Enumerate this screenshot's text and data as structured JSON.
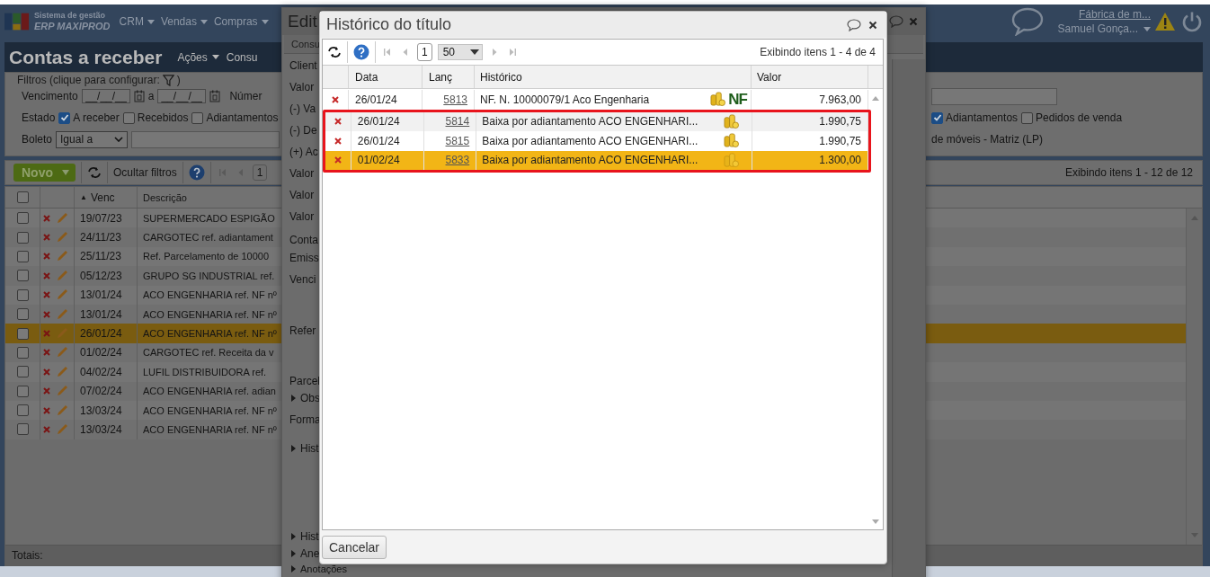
{
  "header": {
    "brand_line1": "Sistema de gestão",
    "brand_line2": "ERP MAXIPROD",
    "menus": [
      {
        "label": "CRM"
      },
      {
        "label": "Vendas"
      },
      {
        "label": "Compras"
      }
    ],
    "company": "Fábrica de m...",
    "user": "Samuel Gonça..."
  },
  "page": {
    "title": "Contas a receber",
    "menus": [
      {
        "label": "Ações",
        "caret": true
      },
      {
        "label": "Consu",
        "caret": false
      }
    ],
    "filters": {
      "legend": "Filtros (clique para configurar:",
      "legend_end": ")",
      "due_label": "Vencimento",
      "date_from": "__/__/__",
      "range_sep": "a",
      "date_to": "__/__/__",
      "number_label": "Númer",
      "state_label": "Estado",
      "states": [
        {
          "label": "A receber",
          "checked": true
        },
        {
          "label": "Recebidos",
          "checked": false
        },
        {
          "label": "Adiantamentos",
          "checked": false
        }
      ],
      "states_right": [
        {
          "label": "Adiantamentos",
          "checked": true
        },
        {
          "label": "Pedidos de venda",
          "checked": false
        }
      ],
      "boleto_label": "Boleto",
      "boleto_op": "Igual a",
      "company_text": "de móveis - Matriz (LP)"
    },
    "toolbar": {
      "new_label": "Novo",
      "hide_filters": "Ocultar filtros",
      "page": "1",
      "showing": "Exibindo itens 1 - 12 de 12"
    },
    "table": {
      "all_checked": false,
      "columns": [
        {
          "label": "Venc",
          "sort_icon": "▲"
        },
        {
          "label": "Descrição"
        }
      ],
      "rows": [
        {
          "checked": false,
          "selected": false,
          "due": "19/07/23",
          "description": "SUPERMERCADO ESPIGÃO"
        },
        {
          "checked": false,
          "selected": false,
          "due": "24/11/23",
          "description": "CARGOTEC ref. adiantament"
        },
        {
          "checked": false,
          "selected": false,
          "due": "25/11/23",
          "description": "Ref. Parcelamento de 10000"
        },
        {
          "checked": false,
          "selected": false,
          "due": "05/12/23",
          "description": "GRUPO SG INDUSTRIAL ref."
        },
        {
          "checked": false,
          "selected": false,
          "due": "13/01/24",
          "description": "ACO ENGENHARIA ref. NF nº"
        },
        {
          "checked": false,
          "selected": false,
          "due": "13/01/24",
          "description": "ACO ENGENHARIA ref. NF nº"
        },
        {
          "checked": false,
          "selected": true,
          "due": "26/01/24",
          "description": "ACO ENGENHARIA ref. NF nº"
        },
        {
          "checked": false,
          "selected": false,
          "due": "01/02/24",
          "description": "CARGOTEC ref. Receita da v"
        },
        {
          "checked": false,
          "selected": false,
          "due": "04/02/24",
          "description": "LUFIL DISTRIBUIDORA ref."
        },
        {
          "checked": false,
          "selected": false,
          "due": "07/02/24",
          "description": "ACO ENGENHARIA ref. adian"
        },
        {
          "checked": false,
          "selected": false,
          "due": "13/03/24",
          "description": "ACO ENGENHARIA ref. NF nº"
        },
        {
          "checked": false,
          "selected": false,
          "due": "13/03/24",
          "description": "ACO ENGENHARIA ref. NF nº"
        }
      ],
      "totals_label": "Totais:"
    }
  },
  "edit_dialog": {
    "title": "Edit",
    "tab": "Consu",
    "fields": [
      {
        "label": "Client",
        "kind": "label"
      },
      {
        "label": "Valor",
        "kind": "label"
      },
      {
        "label": "(-) Va",
        "kind": "label"
      },
      {
        "label": "(-) De",
        "kind": "label"
      },
      {
        "label": "(+) Ac",
        "kind": "label"
      },
      {
        "label": "Valor",
        "kind": "label"
      },
      {
        "label": "Valor",
        "kind": "label"
      },
      {
        "label": "Valor",
        "kind": "label"
      },
      {
        "label": "Conta",
        "kind": "label"
      },
      {
        "label": "Emiss",
        "kind": "label"
      },
      {
        "label": "Venci",
        "kind": "label"
      },
      {
        "label": "Refer",
        "kind": "label"
      },
      {
        "label": "Parcel",
        "kind": "label"
      },
      {
        "label": "Obs",
        "kind": "section"
      },
      {
        "label": "Forma",
        "kind": "label"
      },
      {
        "label": "Hist",
        "kind": "section"
      },
      {
        "label": "Hist",
        "kind": "section"
      },
      {
        "label": "Ane",
        "kind": "section"
      },
      {
        "label": "Anotações",
        "kind": "section"
      }
    ]
  },
  "history_dialog": {
    "title": "Histórico do título",
    "toolbar": {
      "page": "1",
      "page_size": "50",
      "showing": "Exibindo itens 1 - 4 de 4"
    },
    "columns": [
      {
        "label": "Data"
      },
      {
        "label": "Lanç"
      },
      {
        "label": "Histórico"
      },
      {
        "label": "Valor"
      }
    ],
    "rows": [
      {
        "date": "26/01/24",
        "entry": "5813",
        "history": "NF. N. 10000079/1 Aco Engenharia",
        "nf_badge": "NF",
        "value": "7.963,00",
        "selected": false,
        "highlighted": false
      },
      {
        "date": "26/01/24",
        "entry": "5814",
        "history": "Baixa por adiantamento ACO ENGENHARI...",
        "value": "1.990,75",
        "selected": false,
        "highlighted": true
      },
      {
        "date": "26/01/24",
        "entry": "5815",
        "history": "Baixa por adiantamento ACO ENGENHARI...",
        "value": "1.990,75",
        "selected": false,
        "highlighted": true
      },
      {
        "date": "01/02/24",
        "entry": "5833",
        "history": "Baixa por adiantamento ACO ENGENHARI...",
        "value": "1.300,00",
        "selected": true,
        "highlighted": true
      }
    ],
    "cancel": "Cancelar"
  }
}
